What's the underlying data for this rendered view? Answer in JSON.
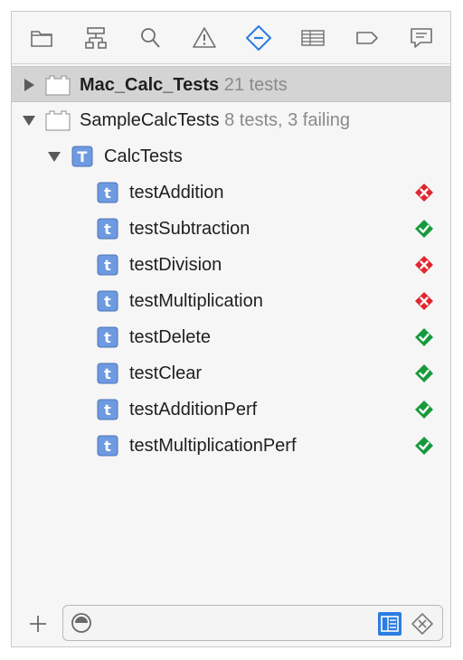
{
  "toolbar": {
    "icons": [
      "folder-icon",
      "hierarchy-icon",
      "search-icon",
      "warning-icon",
      "test-navigator-icon",
      "list-icon",
      "breakpoint-icon",
      "comment-icon"
    ],
    "active_icon": "test-navigator-icon",
    "accent_color": "#2b7de1"
  },
  "tree": {
    "bundles": [
      {
        "name": "Mac_Calc_Tests",
        "summary": "21 tests",
        "expanded": false,
        "selected": true
      },
      {
        "name": "SampleCalcTests",
        "summary": "8 tests, 3 failing",
        "expanded": true,
        "selected": false
      }
    ],
    "class_item": {
      "name": "CalcTests",
      "expanded": true
    },
    "tests": [
      {
        "name": "testAddition",
        "status": "failed"
      },
      {
        "name": "testSubtraction",
        "status": "passed"
      },
      {
        "name": "testDivision",
        "status": "failed"
      },
      {
        "name": "testMultiplication",
        "status": "failed"
      },
      {
        "name": "testDelete",
        "status": "passed"
      },
      {
        "name": "testClear",
        "status": "passed"
      },
      {
        "name": "testAdditionPerf",
        "status": "passed"
      },
      {
        "name": "testMultiplicationPerf",
        "status": "passed"
      }
    ],
    "colors": {
      "failed": "#e0262e",
      "passed": "#179a3c",
      "type_icon": "#5c8fd6"
    }
  },
  "bottom": {
    "add_icon": "plus-icon",
    "filter_value": "",
    "filter_placeholder": "",
    "scope_icon": "recent-scope-icon",
    "toggle_icon": "failed-only-toggle-icon",
    "clear_icon": "clear-filter-icon"
  }
}
